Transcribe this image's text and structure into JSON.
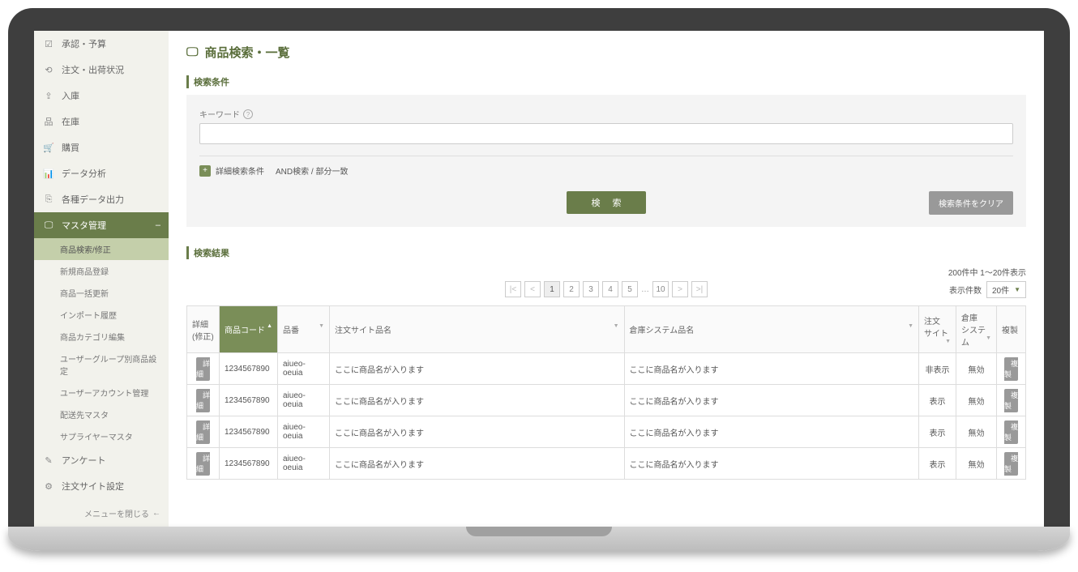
{
  "sidebar": {
    "items": [
      {
        "label": "承認・予算"
      },
      {
        "label": "注文・出荷状況"
      },
      {
        "label": "入庫"
      },
      {
        "label": "在庫"
      },
      {
        "label": "購買"
      },
      {
        "label": "データ分析"
      },
      {
        "label": "各種データ出力"
      },
      {
        "label": "マスタ管理"
      },
      {
        "label": "アンケート"
      },
      {
        "label": "注文サイト設定"
      }
    ],
    "minus": "–",
    "submenu": [
      "商品検索/修正",
      "新規商品登録",
      "商品一括更新",
      "インポート履歴",
      "商品カテゴリ編集",
      "ユーザーグループ別商品設定",
      "ユーザーアカウント管理",
      "配送先マスタ",
      "サプライヤーマスタ"
    ],
    "close": "メニューを閉じる"
  },
  "page": {
    "title": "商品検索・一覧",
    "section_search": "検索条件",
    "keyword_label": "キーワード",
    "keyword_value": "",
    "adv_label": "詳細検索条件",
    "adv_note": "AND検索 / 部分一致",
    "btn_search": "検 索",
    "btn_clear": "検索条件をクリア",
    "section_result": "検索結果",
    "result_count": "200件中 1〜20件表示",
    "pages": [
      "1",
      "2",
      "3",
      "4",
      "5"
    ],
    "page_last": "10",
    "per_page_label": "表示件数",
    "per_page_value": "20件",
    "columns": {
      "detail": "詳細\n(修正)",
      "code": "商品コード",
      "number": "品番",
      "site_name": "注文サイト品名",
      "sys_name": "倉庫システム品名",
      "order_site": "注文\nサイト",
      "warehouse": "倉庫\nシステム",
      "copy": "複製"
    },
    "detail_btn": "詳細",
    "copy_btn": "複製",
    "rows": [
      {
        "code": "1234567890",
        "number": "aiueo-oeuia",
        "site": "ここに商品名が入ります",
        "sys": "ここに商品名が入ります",
        "order": "非表示",
        "wh": "無効"
      },
      {
        "code": "1234567890",
        "number": "aiueo-oeuia",
        "site": "ここに商品名が入ります",
        "sys": "ここに商品名が入ります",
        "order": "表示",
        "wh": "無効"
      },
      {
        "code": "1234567890",
        "number": "aiueo-oeuia",
        "site": "ここに商品名が入ります",
        "sys": "ここに商品名が入ります",
        "order": "表示",
        "wh": "無効"
      },
      {
        "code": "1234567890",
        "number": "aiueo-oeuia",
        "site": "ここに商品名が入ります",
        "sys": "ここに商品名が入ります",
        "order": "表示",
        "wh": "無効"
      }
    ]
  }
}
